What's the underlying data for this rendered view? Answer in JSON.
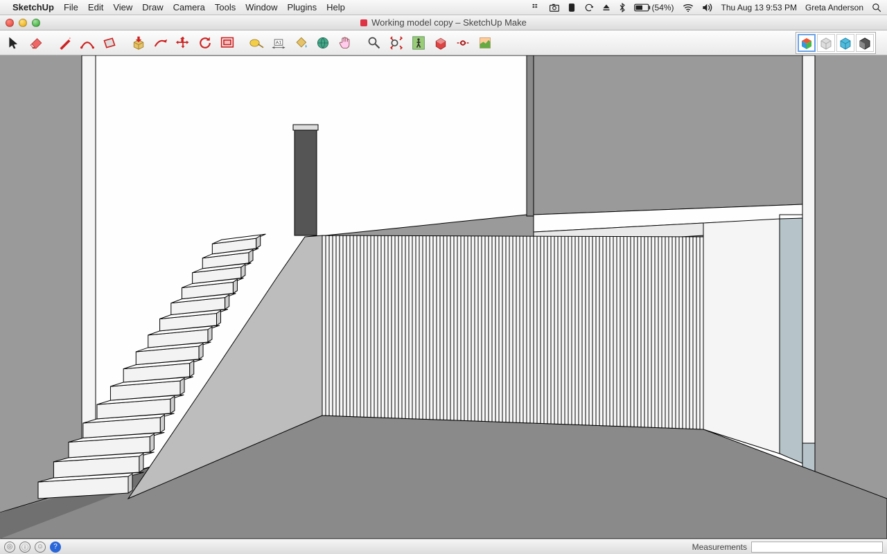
{
  "menubar": {
    "app": "SketchUp",
    "items": [
      "File",
      "Edit",
      "View",
      "Draw",
      "Camera",
      "Tools",
      "Window",
      "Plugins",
      "Help"
    ],
    "battery": "(54%)",
    "datetime": "Thu Aug 13  9:53 PM",
    "user": "Greta Anderson"
  },
  "window": {
    "title": "Working model copy – SketchUp Make"
  },
  "toolbar": {
    "tools": [
      "select-tool",
      "eraser-tool",
      "line-tool",
      "arc-tool",
      "rectangle-tool",
      "pushpull-tool",
      "followme-tool",
      "move-tool",
      "rotate-tool",
      "offset-tool",
      "tapemeasure-tool",
      "dimension-tool",
      "paintbucket-tool",
      "component-tool",
      "pan-tool",
      "zoom-tool",
      "zoomextents-tool",
      "walk-tool",
      "sectionplane-tool",
      "lookaround-tool",
      "addlocation-tool"
    ]
  },
  "statusbar": {
    "measurements_label": "Measurements",
    "measurements_value": ""
  }
}
